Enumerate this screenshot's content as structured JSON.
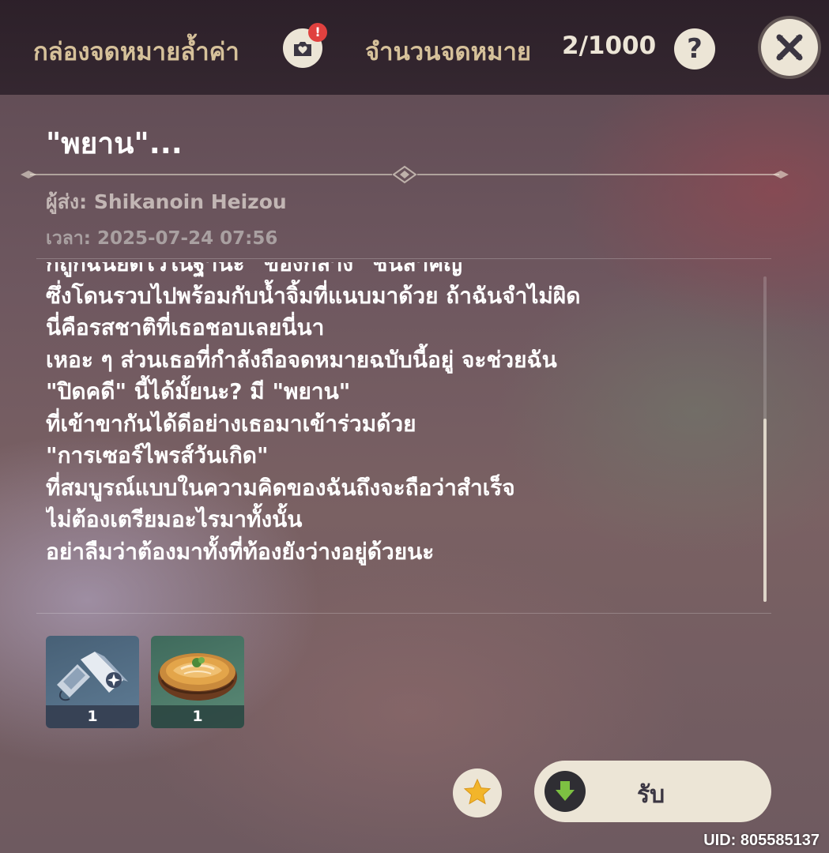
{
  "header": {
    "title": "กล่องจดหมายล้ำค่า",
    "archive_icon": "mail-archive-icon",
    "archive_badge": "!",
    "count_label": "จำนวนจดหมาย",
    "count_value": "2/1000",
    "help_label": "?",
    "close_icon": "close-icon"
  },
  "mail": {
    "subject": "\"พยาน\"...",
    "sender": "ผู้ส่ง: Shikanoin Heizou",
    "time": "เวลา: 2025-07-24 07:56",
    "body_lines": [
      "ก็ถูกฉันยึดไว้ในฐานะ \"ของกลาง\" ชิ้นสำคัญ",
      "ซึ่งโดนรวบไปพร้อมกับน้ำจิ้มที่แนบมาด้วย ถ้าฉันจำไม่ผิด",
      "นี่คือรสชาติที่เธอชอบเลยนี่นา",
      "เหอะ ๆ ส่วนเธอที่กำลังถือจดหมายฉบับนี้อยู่ จะช่วยฉัน",
      "\"ปิดคดี\" นี้ได้มั้ยนะ? มี \"พยาน\"",
      "ที่เข้าขากันได้ดีอย่างเธอมาเข้าร่วมด้วย",
      "\"การเซอร์ไพรส์วันเกิด\"",
      "ที่สมบูรณ์แบบในความคิดของฉันถึงจะถือว่าสำเร็จ",
      "ไม่ต้องเตรียมอะไรมาทั้งนั้น",
      "อย่าลืมว่าต้องมาทั้งที่ท้องยังว่างอยู่ด้วยนะ"
    ]
  },
  "attachments": [
    {
      "icon": "birthday-dish-icon",
      "count": "1"
    },
    {
      "icon": "fried-fish-bowl-icon",
      "count": "1"
    }
  ],
  "actions": {
    "favorite_icon": "star-icon",
    "claim_icon": "download-arrow-icon",
    "claim_label": "รับ"
  },
  "footer": {
    "uid": "UID: 805585137"
  },
  "colors": {
    "gold_text": "#d6c19a",
    "cream_button": "#ece5d6",
    "badge_red": "#e0413f",
    "star_yellow": "#f2b52a",
    "claim_green": "#7dc142"
  }
}
